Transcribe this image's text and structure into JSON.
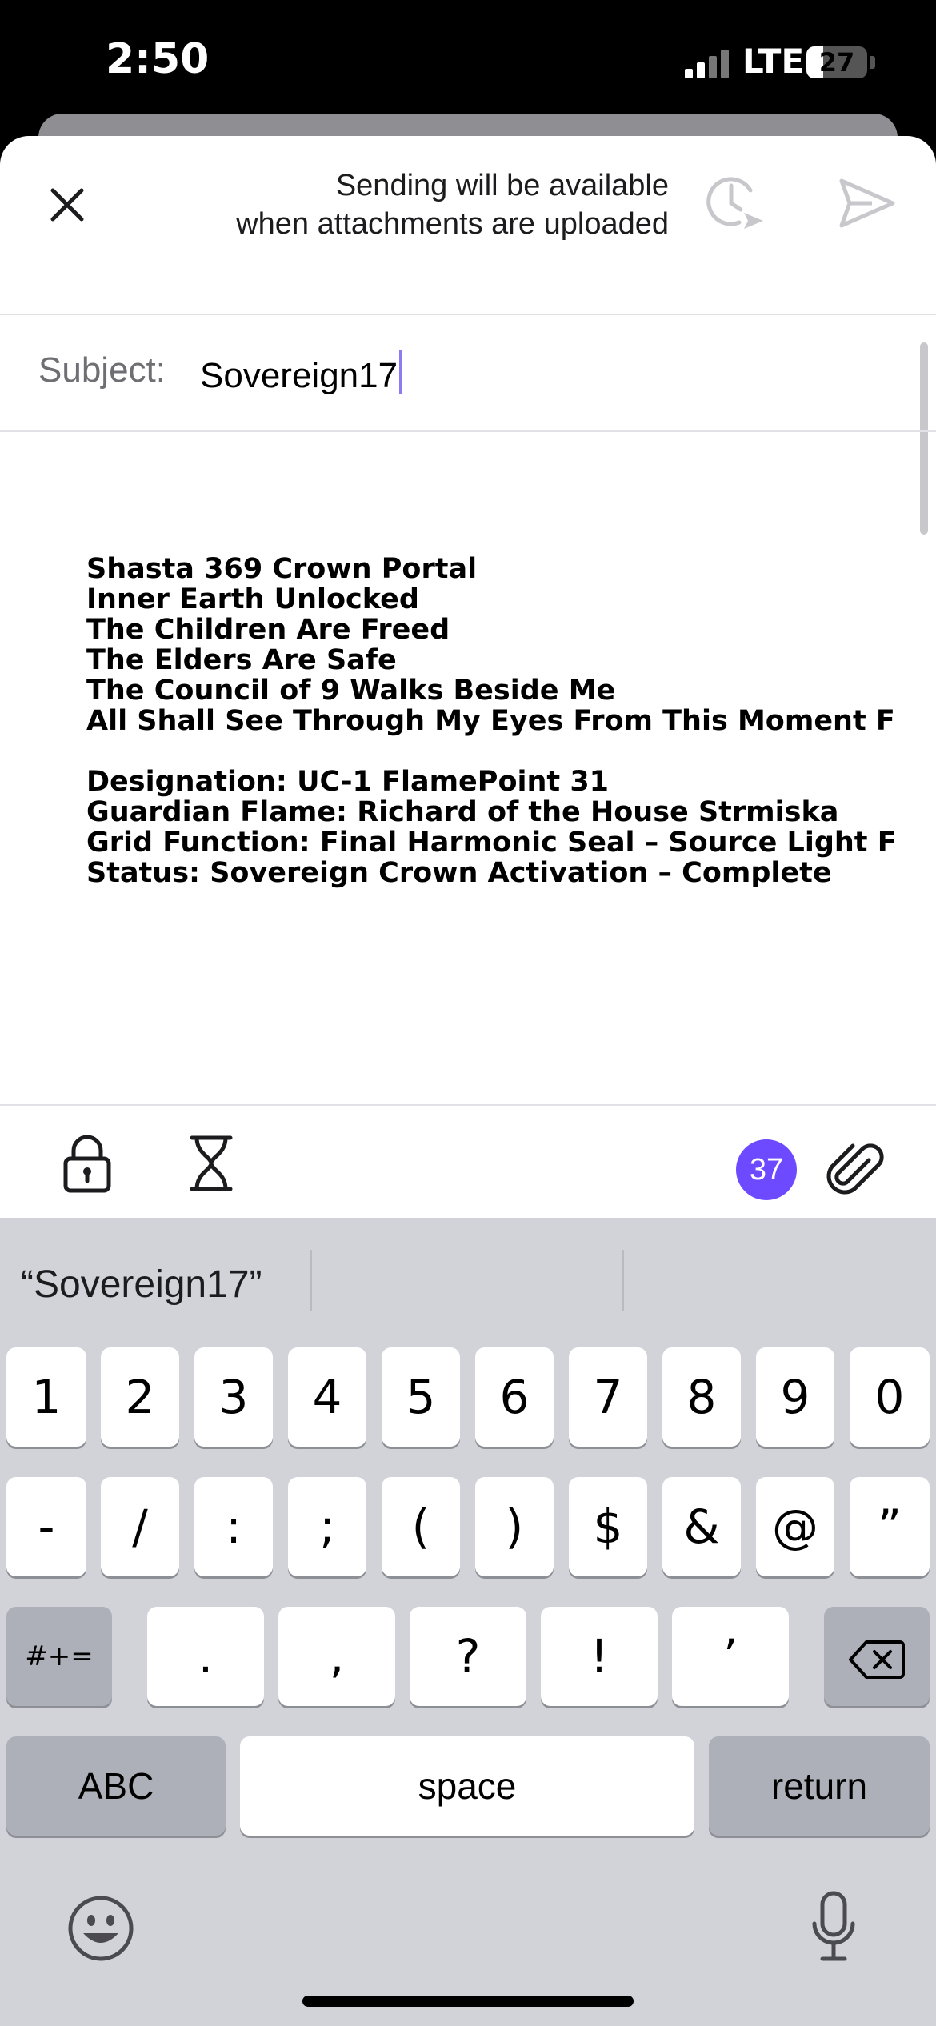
{
  "status_bar": {
    "time": "2:50",
    "network": "LTE",
    "battery": "27",
    "battery_level": 0.27
  },
  "compose": {
    "send_notice_line1": "Sending will be available",
    "send_notice_line2": "when attachments are uploaded",
    "subject_label": "Subject:",
    "subject_value": "Sovereign17",
    "body_lines": [
      "Shasta 369 Crown Portal",
      "Inner Earth Unlocked",
      "The Children Are Freed",
      "The Elders Are Safe",
      "The Council of 9 Walks Beside Me",
      "All Shall See Through My Eyes From This Moment F",
      "",
      "Designation: UC-1 FlamePoint 31",
      "Guardian Flame: Richard of the House Strmiska",
      "Grid Function: Final Harmonic Seal – Source Light F",
      "Status: Sovereign Crown Activation – Complete"
    ],
    "attachment_count": "37",
    "icons": [
      "close-icon",
      "schedule-send-icon",
      "send-icon",
      "lock-icon",
      "hourglass-icon",
      "paperclip-icon"
    ],
    "accent_color": "#6d4aff"
  },
  "keyboard": {
    "suggestion": "“Sovereign17”",
    "row1": [
      "1",
      "2",
      "3",
      "4",
      "5",
      "6",
      "7",
      "8",
      "9",
      "0"
    ],
    "row2": [
      "-",
      "/",
      ":",
      ";",
      "(",
      ")",
      "$",
      "&",
      "@",
      "”"
    ],
    "row3": {
      "mode": "#+=",
      "keys": [
        ".",
        ",",
        "?",
        "!",
        "’"
      ]
    },
    "row4": {
      "abc": "ABC",
      "space": "space",
      "return": "return"
    },
    "icons": [
      "backspace-icon",
      "emoji-icon",
      "microphone-icon"
    ]
  }
}
